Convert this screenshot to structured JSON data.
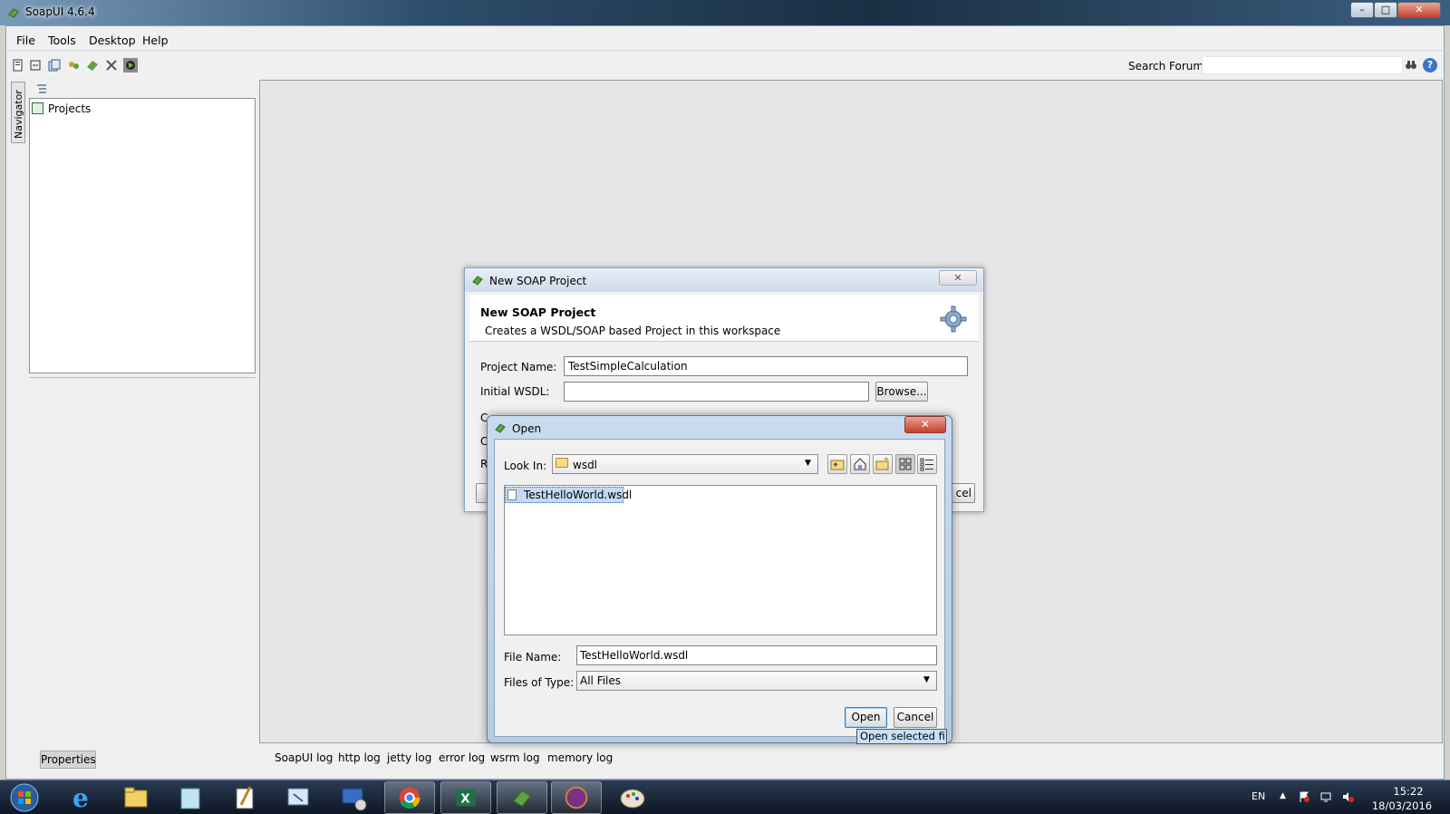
{
  "window": {
    "title": "SoapUI 4.6.4",
    "min": "–",
    "max": "□",
    "close": "✕"
  },
  "menu": [
    "File",
    "Tools",
    "Desktop",
    "Help"
  ],
  "toolbar": {
    "search_label": "Search Forum",
    "search_value": "",
    "help": "?"
  },
  "navigator": {
    "tab_label": "Navigator",
    "tree_root": "Projects"
  },
  "left_panel": {
    "properties_button": "Properties"
  },
  "log_tabs": [
    "SoapUI log",
    "http log",
    "jetty log",
    "error log",
    "wsrm log",
    "memory log"
  ],
  "soap_dialog": {
    "title": "New SOAP Project",
    "heading": "New SOAP Project",
    "description": "Creates a WSDL/SOAP based Project in this workspace",
    "project_name_label": "Project Name:",
    "project_name_value": "TestSimpleCalculation",
    "initial_wsdl_label": "Initial WSDL:",
    "initial_wsdl_value": "",
    "browse_button": "Browse...",
    "partial_label_1": "C",
    "partial_label_2": "C",
    "partial_label_3": "R",
    "cancel_partial": "cel"
  },
  "open_dialog": {
    "title": "Open",
    "close": "✕",
    "look_in_label": "Look In:",
    "look_in_value": "wsdl",
    "files": [
      "TestHelloWorld.wsdl"
    ],
    "file_name_label": "File Name:",
    "file_name_value": "TestHelloWorld.wsdl",
    "files_of_type_label": "Files of Type:",
    "files_of_type_value": "All Files",
    "open_button": "Open",
    "cancel_button": "Cancel",
    "tooltip": "Open selected file"
  },
  "taskbar": {
    "language": "EN",
    "time": "15:22",
    "date": "18/03/2016"
  }
}
